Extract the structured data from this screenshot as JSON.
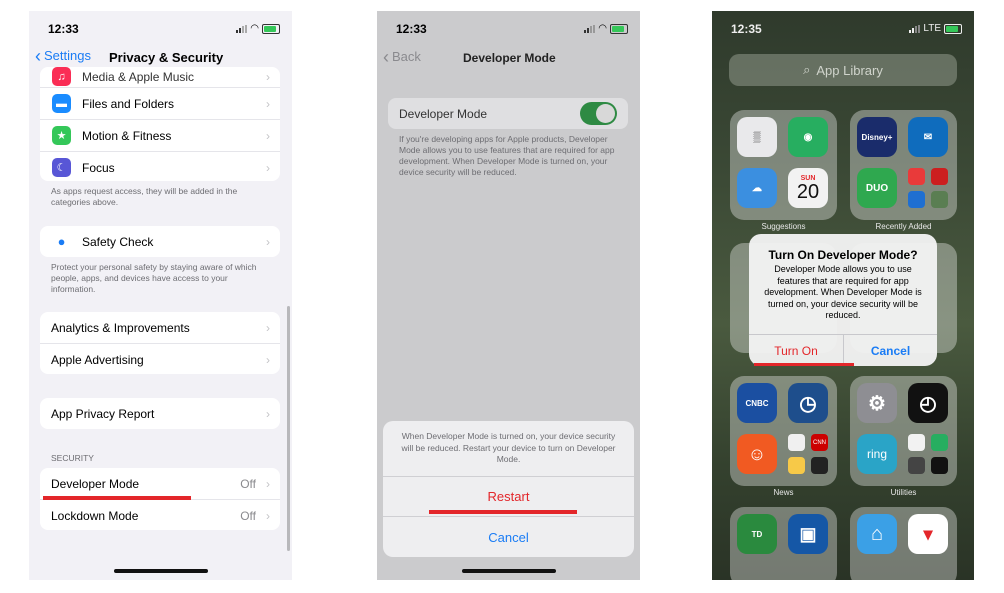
{
  "phone1": {
    "time": "12:33",
    "nav": {
      "back_label": "Settings",
      "title": "Privacy & Security"
    },
    "group1": [
      {
        "label": "Media & Apple Music",
        "icon_color": "#fa2d55"
      },
      {
        "label": "Files and Folders",
        "icon_color": "#1a8cff"
      },
      {
        "label": "Motion & Fitness",
        "icon_color": "#34c759"
      },
      {
        "label": "Focus",
        "icon_color": "#5856d6"
      }
    ],
    "group1_footer": "As apps request access, they will be added in the categories above.",
    "safety_check": "Safety Check",
    "safety_footer": "Protect your personal safety by staying aware of which people, apps, and devices have access to your information.",
    "group3": [
      "Analytics & Improvements",
      "Apple Advertising"
    ],
    "app_privacy_report": "App Privacy Report",
    "security_header": "SECURITY",
    "developer_mode": {
      "label": "Developer Mode",
      "value": "Off"
    },
    "lockdown_mode": {
      "label": "Lockdown Mode",
      "value": "Off"
    }
  },
  "phone2": {
    "time": "12:33",
    "nav": {
      "back_label": "Back",
      "title": "Developer Mode"
    },
    "toggle_label": "Developer Mode",
    "toggle_on": true,
    "description": "If you're developing apps for Apple products, Developer Mode allows you to use features that are required for app development. When Developer Mode is turned on, your device security will be reduced.",
    "sheet_message": "When Developer Mode is turned on, your device security will be reduced. Restart your device to turn on Developer Mode.",
    "restart_label": "Restart",
    "cancel_label": "Cancel"
  },
  "phone3": {
    "time": "12:35",
    "carrier": "LTE",
    "search_placeholder": "App Library",
    "calendar_day": "SUN",
    "calendar_date": "20",
    "categories": {
      "suggestions": "Suggestions",
      "recently_added": "Recently Added",
      "news": "News",
      "utilities": "Utilities"
    },
    "alert": {
      "title": "Turn On Developer Mode?",
      "message": "Developer Mode allows you to use features that are required for app development. When Developer Mode is turned on, your device security will be reduced.",
      "turn_on_label": "Turn On",
      "cancel_label": "Cancel"
    },
    "app_labels": {
      "disney": "Disney+",
      "duo": "DUO",
      "cnbc": "CNBC",
      "ring": "ring",
      "cnn": "CNN",
      "td": "TD"
    }
  },
  "colors": {
    "ios_blue": "#1a7cf5",
    "ios_red": "#e3262a",
    "toggle_green": "#34c759",
    "annotation_red": "#e3262a"
  }
}
